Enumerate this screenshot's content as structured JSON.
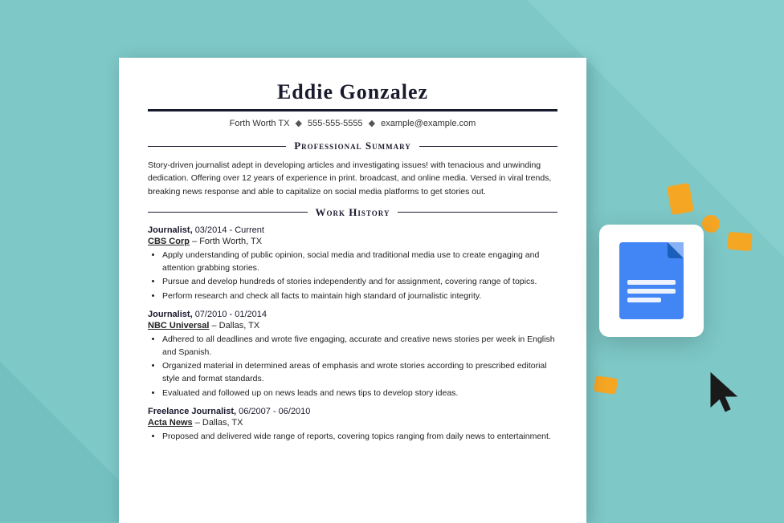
{
  "background": {
    "color": "#7ec8c8"
  },
  "resume": {
    "name": "Eddie Gonzalez",
    "contact": {
      "location": "Forth Worth TX",
      "phone": "555-555-5555",
      "email": "example@example.com"
    },
    "sections": {
      "professional_summary": {
        "heading": "Professional Summary",
        "text": "Story-driven journalist adept in developing articles and investigating issues! with tenacious and unwinding dedication. Offering over 12 years of experience in print. broadcast, and online media. Versed in viral trends, breaking news response and able to capitalize on social media platforms to get stories out."
      },
      "work_history": {
        "heading": "Work History",
        "jobs": [
          {
            "title": "Journalist,",
            "dates": "03/2014 - Current",
            "company": "CBS Corp",
            "location": "Forth Worth, TX",
            "bullets": [
              "Apply understanding of public opinion, social media and traditional media use to create engaging and attention grabbing stories.",
              "Pursue and develop hundreds of stories independently and for assignment, covering range of topics.",
              "Perform research and check all facts to maintain high standard of journalistic integrity."
            ]
          },
          {
            "title": "Journalist,",
            "dates": "07/2010 - 01/2014",
            "company": "NBC Universal",
            "location": "Dallas, TX",
            "bullets": [
              "Adhered to all deadlines and wrote five engaging, accurate and creative news stories per week in English and Spanish.",
              "Organized material in determined areas of emphasis and wrote stories according to prescribed editorial style and format standards.",
              "Evaluated and followed up on news leads and news tips to develop story ideas."
            ]
          },
          {
            "title": "Freelance Journalist,",
            "dates": "06/2007 - 06/2010",
            "company": "Acta News",
            "location": "Dallas, TX",
            "bullets": [
              "Proposed and delivered wide range of reports, covering topics ranging from daily news to entertainment."
            ]
          }
        ]
      }
    }
  },
  "gdocs_icon": {
    "alt": "Google Docs icon"
  },
  "cursor": {
    "alt": "Mouse cursor arrow"
  }
}
